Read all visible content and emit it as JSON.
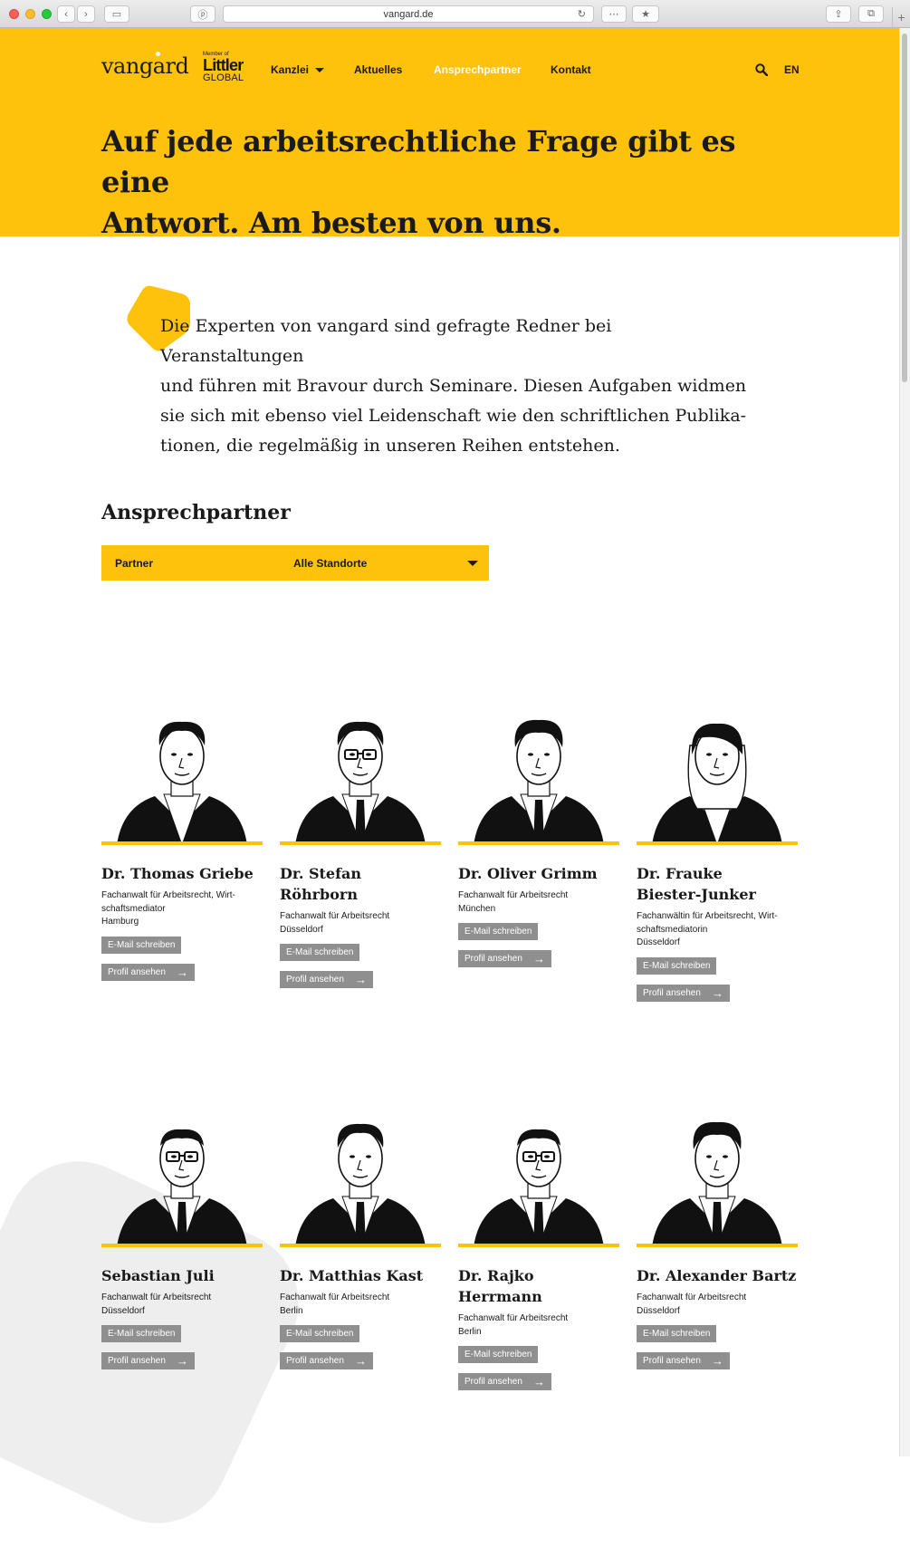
{
  "browser": {
    "url": "vangard.de",
    "newtab": "+"
  },
  "header": {
    "logo": "vangard",
    "partner": {
      "member_of": "Member of",
      "name": "Littler",
      "sub": "GLOBAL"
    },
    "nav": [
      {
        "label": "Kanzlei",
        "has_dropdown": true
      },
      {
        "label": "Aktuelles"
      },
      {
        "label": "Ansprechpartner",
        "active": true
      },
      {
        "label": "Kontakt"
      }
    ],
    "lang": "EN",
    "accent": "#fec20c"
  },
  "hero": {
    "title_line1": "Auf jede arbeitsrechtliche Frage gibt es eine",
    "title_line2": "Antwort. Am besten von uns."
  },
  "intro": {
    "lines": [
      "Die Experten von vangard sind gefragte Redner bei Veranstaltungen",
      "und führen mit Bravour durch Seminare. Diesen Aufgaben widmen",
      "sie sich mit ebenso viel Leidenschaft wie den schriftlichen Publika-",
      "tionen, die regelmäßig in unseren Reihen entstehen."
    ]
  },
  "section": {
    "title": "Ansprechpartner",
    "filter": {
      "type": "Partner",
      "location": "Alle Standorte"
    }
  },
  "buttons": {
    "mail": "E-Mail schreiben",
    "profile": "Profil ansehen"
  },
  "people": [
    {
      "name": "Dr. Thomas Griebe",
      "role": [
        "Fachanwalt für Arbeitsrecht, Wirt-",
        "schaftsmediator"
      ],
      "city": "Hamburg"
    },
    {
      "name": "Dr. Stefan Röhrborn",
      "role": [
        "Fachanwalt für Arbeitsrecht"
      ],
      "city": "Düsseldorf"
    },
    {
      "name": "Dr. Oliver Grimm",
      "role": [
        "Fachanwalt für Arbeitsrecht"
      ],
      "city": "München"
    },
    {
      "name_lines": [
        "Dr. Frauke",
        "Biester-Junker"
      ],
      "role": [
        "Fachanwältin für Arbeitsrecht, Wirt-",
        "schaftsmediatorin"
      ],
      "city": "Düsseldorf"
    },
    {
      "name": "Sebastian Juli",
      "role": [
        "Fachanwalt für Arbeitsrecht"
      ],
      "city": "Düsseldorf"
    },
    {
      "name": "Dr. Matthias Kast",
      "role": [
        "Fachanwalt für Arbeitsrecht"
      ],
      "city": "Berlin"
    },
    {
      "name": "Dr. Rajko Herrmann",
      "role": [
        "Fachanwalt für Arbeitsrecht"
      ],
      "city": "Berlin"
    },
    {
      "name": "Dr. Alexander Bartz",
      "role": [
        "Fachanwalt für Arbeitsrecht"
      ],
      "city": "Düsseldorf"
    }
  ]
}
